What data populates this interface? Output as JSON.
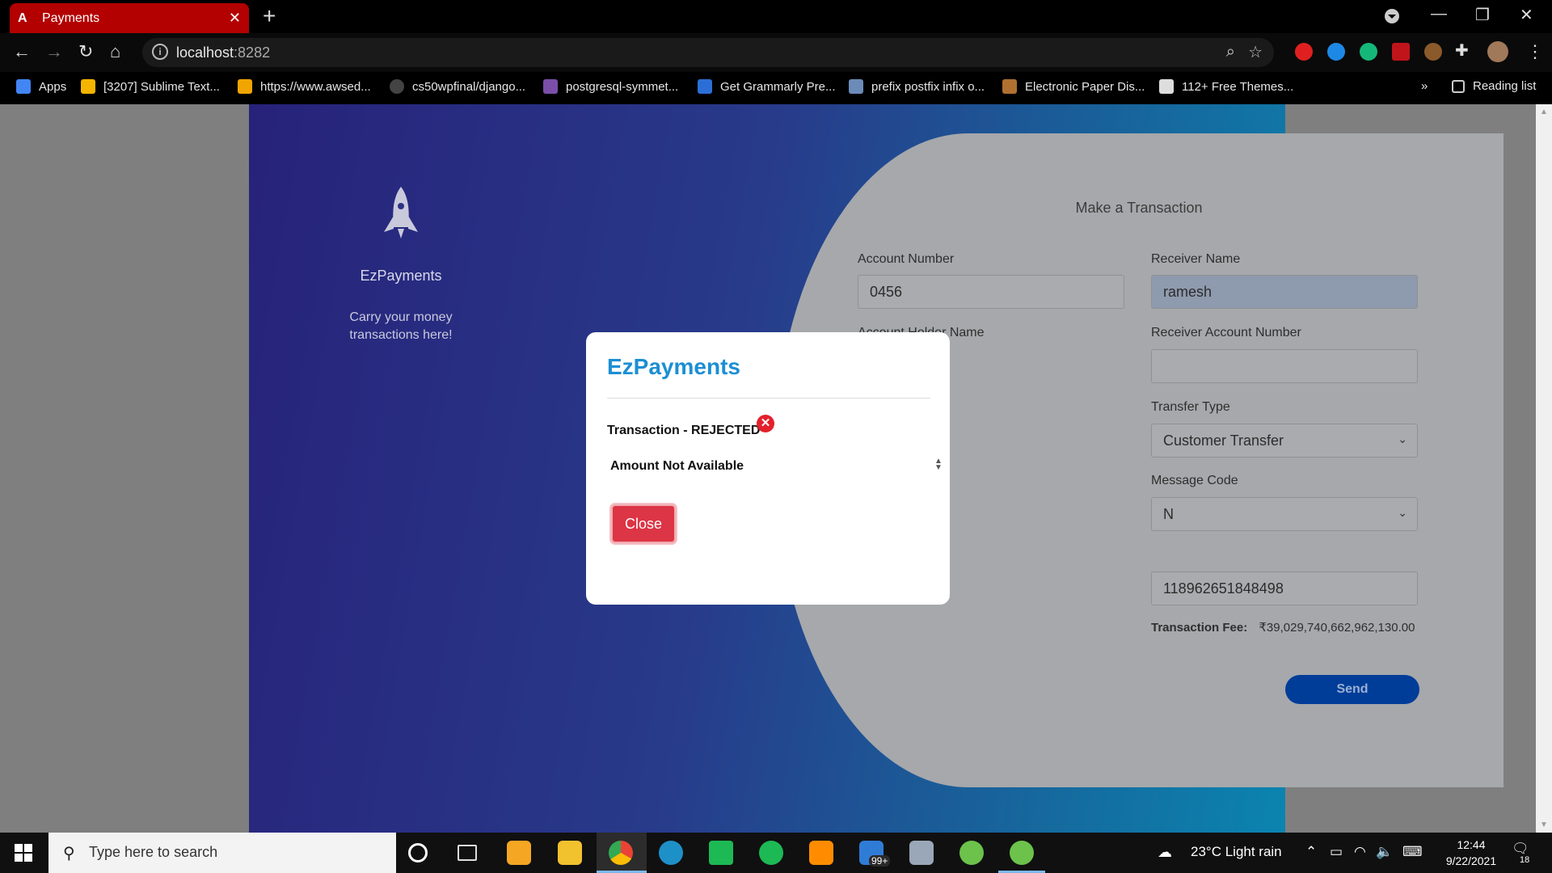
{
  "browser": {
    "tab_title": "Payments",
    "tab_favicon": "A",
    "url_host": "localhost",
    "url_port": ":8282",
    "bookmarks": [
      {
        "label": "Apps",
        "color": "#4285f4"
      },
      {
        "label": "[3207] Sublime Text...",
        "color": "#f4b400"
      },
      {
        "label": "https://www.awsed...",
        "color": "#f0a500"
      },
      {
        "label": "cs50wpfinal/django...",
        "color": "#444444"
      },
      {
        "label": "postgresql-symmet...",
        "color": "#7b4fa8"
      },
      {
        "label": "Get Grammarly Pre...",
        "color": "#2b6fd6"
      },
      {
        "label": "prefix postfix infix o...",
        "color": "#6b8bb8"
      },
      {
        "label": "Electronic Paper Dis...",
        "color": "#b07030"
      },
      {
        "label": "112+ Free Themes...",
        "color": "#dddddd"
      }
    ],
    "bookmarks_overflow": "»",
    "reading_list": "Reading list"
  },
  "app": {
    "brand_name": "EzPayments",
    "tagline_line1": "Carry your money",
    "tagline_line2": "transactions here!",
    "form_title": "Make a Transaction",
    "fields": {
      "account_number_label": "Account Number",
      "account_number_value": "0456",
      "account_holder_label": "Account Holder Name",
      "receiver_name_label": "Receiver Name",
      "receiver_name_value": "ramesh",
      "receiver_account_label": "Receiver Account Number",
      "transfer_type_label": "Transfer Type",
      "transfer_type_value": "Customer Transfer",
      "code_label": "Message Code",
      "code_value": "N",
      "amount_value": "118962651848498"
    },
    "fee_label": "Transaction Fee:",
    "fee_value": "₹39,029,740,662,962,130.00",
    "send_label": "Send"
  },
  "modal": {
    "title": "EzPayments",
    "status": "Transaction - REJECTED",
    "status_icon": "close-circle-icon",
    "reason": "Amount Not Available",
    "close_label": "Close"
  },
  "taskbar": {
    "search_placeholder": "Type here to search",
    "mail_badge": "99+",
    "weather": "23°C  Light rain",
    "time": "12:44",
    "date": "9/22/2021",
    "notification_count": "18"
  },
  "colors": {
    "accent_blue": "#1b8fd3",
    "reject_red": "#e3212c",
    "close_button": "#dc3545",
    "send_button": "#003d99"
  }
}
